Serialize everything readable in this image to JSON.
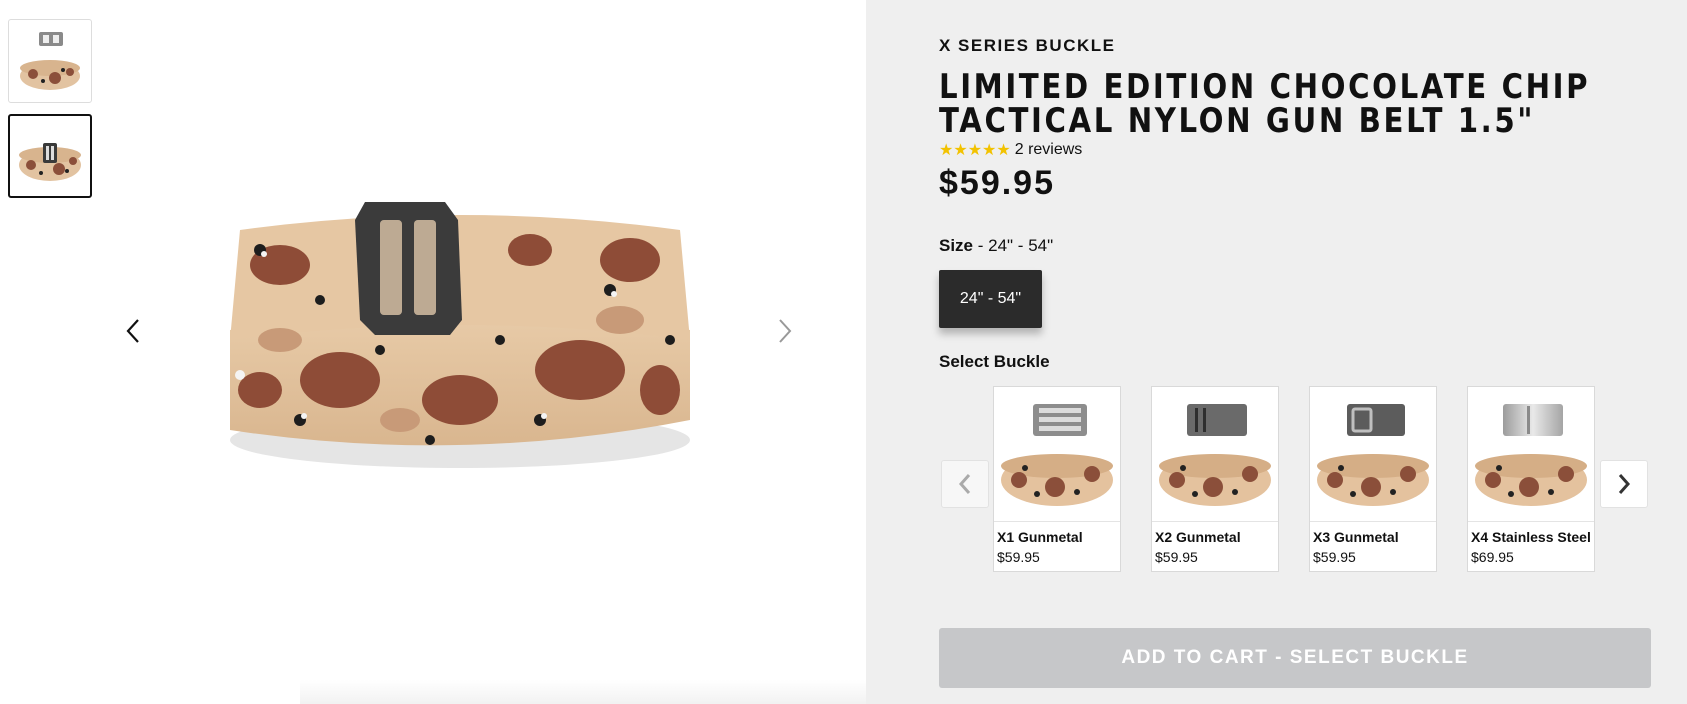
{
  "gallery": {
    "thumbnails": [
      {
        "name": "belt-with-buckle-thumbnail-1"
      },
      {
        "name": "belt-with-buckle-thumbnail-2",
        "active": true
      }
    ],
    "prev_icon": "chevron-left-icon",
    "next_icon": "chevron-right-icon"
  },
  "product": {
    "series": "X SERIES BUCKLE",
    "title_line1": "LIMITED EDITION CHOCOLATE CHIP",
    "title_line2": "TACTICAL NYLON GUN BELT 1.5\"",
    "stars": "★★★★★",
    "reviews": "2 reviews",
    "price": "$59.95",
    "size_label": "Size",
    "size_value": " - 24\" - 54\"",
    "size_option": "24\" - 54\"",
    "select_buckle_label": "Select Buckle",
    "buckles": [
      {
        "name": "X1 Gunmetal",
        "price": "$59.95"
      },
      {
        "name": "X2 Gunmetal",
        "price": "$59.95"
      },
      {
        "name": "X3 Gunmetal",
        "price": "$59.95"
      },
      {
        "name": "X4 Stainless Steel",
        "price": "$69.95"
      }
    ],
    "cart_label": "ADD TO CART - SELECT BUCKLE"
  },
  "colors": {
    "panel_bg": "#efefef",
    "star": "#f2c200",
    "size_btn": "#2b2b2b",
    "cart_disabled": "#c6c7c9"
  }
}
